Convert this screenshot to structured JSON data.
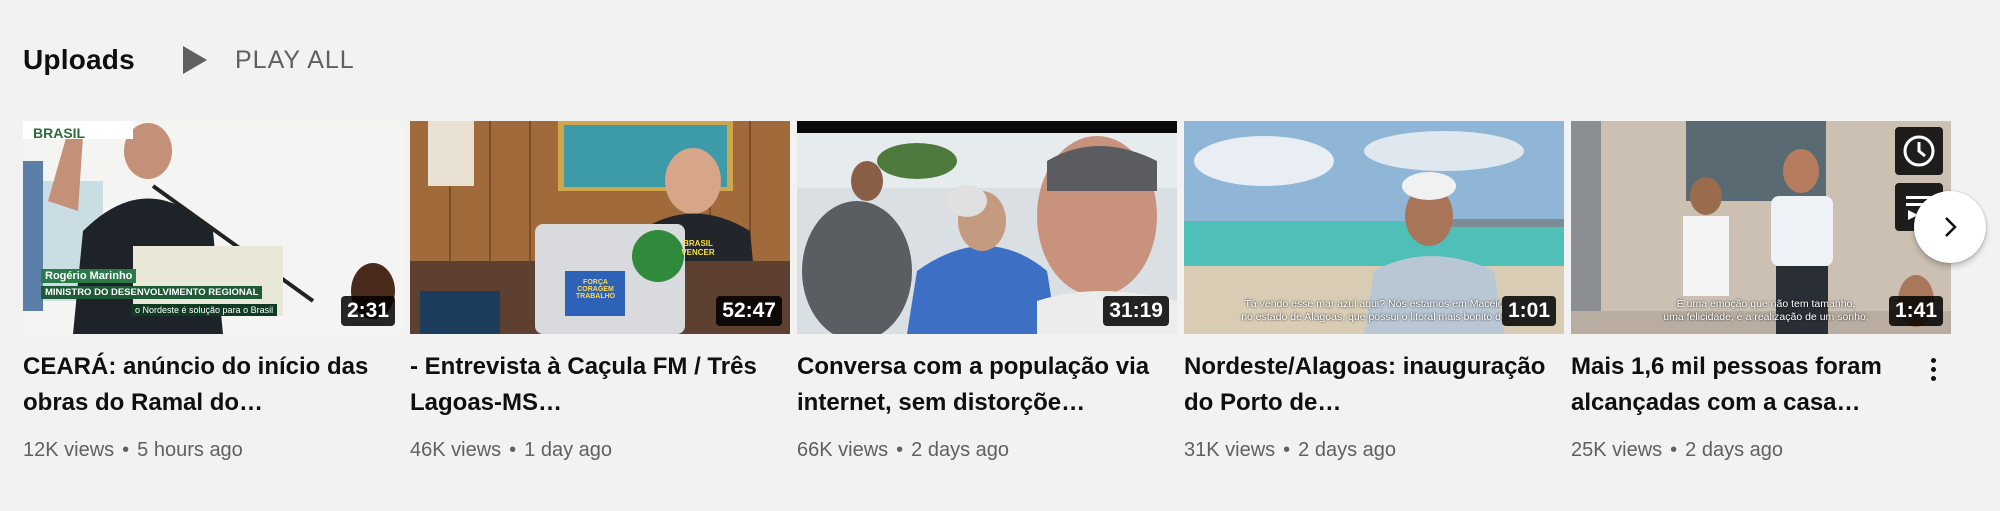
{
  "section": {
    "title": "Uploads",
    "play_all_label": "PLAY ALL"
  },
  "videos": [
    {
      "title": "CEARÁ: anúncio do início das obras do Ramal do…",
      "views": "12K views",
      "age": "5 hours ago",
      "duration": "2:31",
      "overlay": {
        "logo": "BRASIL",
        "name": "Rogério Marinho",
        "role": "MINISTRO DO DESENVOLVIMENTO REGIONAL",
        "ticker": "o Nordeste é solução para o Brasil"
      }
    },
    {
      "title": "- Entrevista à Caçula FM / Três Lagoas-MS…",
      "views": "46K views",
      "age": "1 day ago",
      "duration": "52:47",
      "overlay": {
        "sticker1": "FORÇA CORAGEM TRABALHO",
        "sticker2": "BRASIL VENCER"
      }
    },
    {
      "title": "Conversa com a população via internet, sem distorçõe…",
      "views": "66K views",
      "age": "2 days ago",
      "duration": "31:19"
    },
    {
      "title": "Nordeste/Alagoas: inauguração do Porto de…",
      "views": "31K views",
      "age": "2 days ago",
      "duration": "1:01",
      "overlay": {
        "subtitle_line1": "Tá vendo esse mar azul aqui? Nós estamos em Maceió",
        "subtitle_line2": "no estado de Alagoas, que possui o litoral mais bonito do"
      }
    },
    {
      "title": "Mais 1,6 mil pessoas foram alcançadas com a casa…",
      "views": "25K views",
      "age": "2 days ago",
      "duration": "1:41",
      "overlay": {
        "subtitle_line1": "É uma emoção que não tem tamanho,",
        "subtitle_line2": "uma felicidade, é a realização de um sonho,"
      }
    }
  ],
  "icons": {
    "play": "play-icon",
    "clock": "clock-icon",
    "queue": "add-to-queue-icon",
    "more": "more-vert-icon",
    "next": "chevron-right-icon"
  },
  "colors": {
    "background": "#f2f2f2",
    "text_primary": "#0f0f0f",
    "text_secondary": "#606060"
  }
}
